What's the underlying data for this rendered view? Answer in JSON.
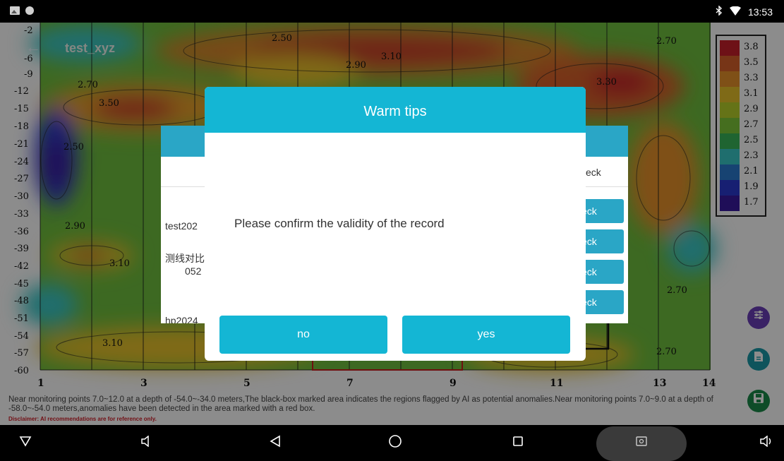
{
  "status_bar": {
    "time": "13:53"
  },
  "chart": {
    "title": "test_xyz",
    "y_ticks": [
      "-2",
      "-6",
      "-9",
      "-12",
      "-15",
      "-18",
      "-21",
      "-24",
      "-27",
      "-30",
      "-33",
      "-36",
      "-39",
      "-42",
      "-45",
      "-48",
      "-51",
      "-54",
      "-57",
      "-60"
    ],
    "x_ticks": [
      "1",
      "3",
      "5",
      "7",
      "9",
      "11",
      "13",
      "14"
    ],
    "contour_labels": [
      "2.50",
      "2.70",
      "2.90",
      "3.10",
      "3.30",
      "3.50",
      "2.70",
      "2.90",
      "3.10",
      "2.50",
      "2.70",
      "3.10",
      "2.70"
    ],
    "legend": [
      {
        "label": "3.8",
        "color": "#c8202a"
      },
      {
        "label": "3.5",
        "color": "#d9622a"
      },
      {
        "label": "3.3",
        "color": "#e8922a"
      },
      {
        "label": "3.1",
        "color": "#e8c12a"
      },
      {
        "label": "2.9",
        "color": "#b8d22a"
      },
      {
        "label": "2.7",
        "color": "#7ec83a"
      },
      {
        "label": "2.5",
        "color": "#3ab65a"
      },
      {
        "label": "2.3",
        "color": "#3ac8c8"
      },
      {
        "label": "2.1",
        "color": "#2a7ad0"
      },
      {
        "label": "1.9",
        "color": "#2a3ad0"
      },
      {
        "label": "1.7",
        "color": "#3a1aa0"
      }
    ]
  },
  "notes": {
    "text": "Near monitoring points 7.0~12.0 at a depth of -54.0~-34.0 meters,The black-box marked area indicates the regions flagged by AI as potential anomalies.Near monitoring points 7.0~9.0 at a depth of -58.0~-54.0 meters,anomalies have been detected in the area marked with a red box.",
    "disclaimer": "Disclaimer: AI recommendations are for reference only."
  },
  "background_dialog": {
    "header_right": "eck",
    "rows": [
      "test202",
      "测线对比",
      "052",
      "hp2024"
    ],
    "check_buttons": [
      "eck",
      "eck",
      "eck",
      "eck"
    ]
  },
  "dialog": {
    "title": "Warm tips",
    "message": "Please confirm the validity of the record",
    "no_label": "no",
    "yes_label": "yes"
  },
  "colors": {
    "accent": "#14b6d4",
    "fab_purple": "#6a3fb8",
    "fab_teal": "#1a9aa8",
    "fab_green": "#1a8a4a"
  }
}
